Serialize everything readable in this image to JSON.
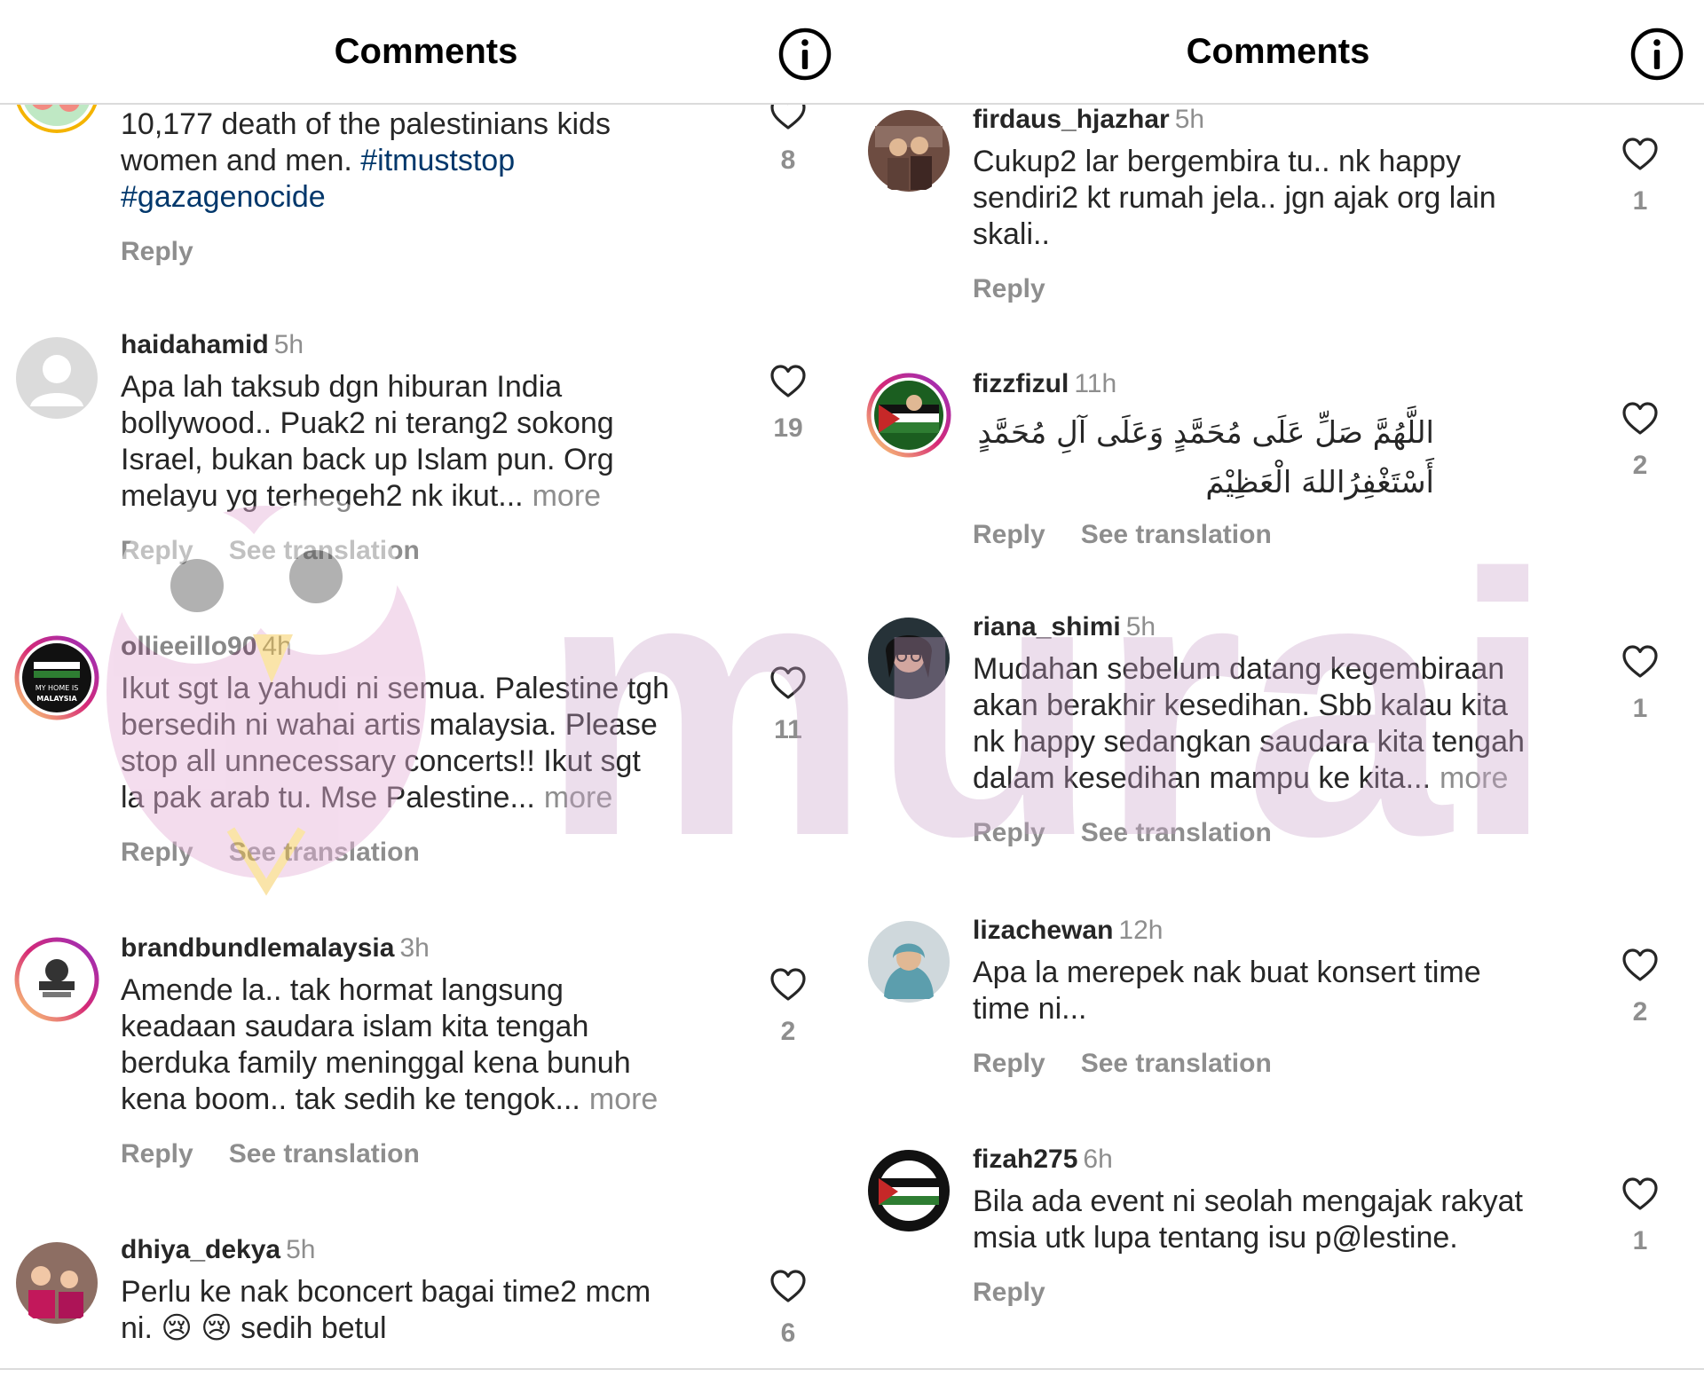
{
  "left": {
    "title": "Comments",
    "comments": [
      {
        "username": "",
        "time": "",
        "text_plain": "10,177 death of the palestinians kids\nwomen and men. ",
        "tag1": "#itmuststop",
        "tag2": "#gazagenocide",
        "reply": "Reply",
        "translation": "",
        "likes": "8"
      },
      {
        "username": "haidahamid",
        "time": "5h",
        "text": "Apa lah taksub dgn hiburan India\nbollywood.. Puak2 ni terang2 sokong\nIsrael, bukan back up Islam pun. Org\nmelayu yg terhegeh2 nk ikut...",
        "more": "more",
        "reply": "Reply",
        "translation": "See translation",
        "likes": "19"
      },
      {
        "username": "ollieeillo90",
        "time": "4h",
        "text": "Ikut sgt la yahudi ni semua. Palestine tgh\nbersedih ni wahai artis malaysia. Please\nstop all unnecessary concerts!! Ikut sgt\nla pak arab tu. Mse Palestine...",
        "more": "more",
        "reply": "Reply",
        "translation": "See translation",
        "likes": "11",
        "avatar_text1": "MY HOME IS",
        "avatar_text2": "MALAYSIA"
      },
      {
        "username": "brandbundlemalaysia",
        "time": "3h",
        "text": "Amende la.. tak hormat langsung\nkeadaan saudara islam kita tengah\nberduka family meninggal kena bunuh\nkena boom.. tak sedih ke tengok...",
        "more": "more",
        "reply": "Reply",
        "translation": "See translation",
        "likes": "2"
      },
      {
        "username": "dhiya_dekya",
        "time": "5h",
        "text": "Perlu ke nak bconcert bagai time2 mcm\nni. 😢 😢  sedih betul",
        "more": "",
        "reply": "",
        "translation": "",
        "likes": "6"
      }
    ]
  },
  "right": {
    "title": "Comments",
    "comments": [
      {
        "username": "firdaus_hjazhar",
        "time": "5h",
        "text": "Cukup2 lar bergembira tu.. nk happy\nsendiri2 kt rumah jela.. jgn ajak org lain\nskali..",
        "more": "",
        "reply": "Reply",
        "translation": "",
        "likes": "1"
      },
      {
        "username": "fizzfizul",
        "time": "11h",
        "text": "اللَّهُمَّ صَلِّ عَلَى مُحَمَّدٍ وَعَلَى آلِ مُحَمَّدٍ\nأَسْتَغْفِرُاللهَ الْعَظِيْمَ",
        "more": "",
        "reply": "Reply",
        "translation": "See translation",
        "likes": "2"
      },
      {
        "username": "riana_shimi",
        "time": "5h",
        "text": "Mudahan sebelum datang kegembiraan\nakan berakhir kesedihan. Sbb kalau kita\nnk happy sedangkan saudara kita tengah\ndalam kesedihan mampu ke kita...",
        "more": "more",
        "reply": "Reply",
        "translation": "See translation",
        "likes": "1"
      },
      {
        "username": "lizachewan",
        "time": "12h",
        "text": "Apa la merepek nak buat konsert time\ntime ni...",
        "more": "",
        "reply": "Reply",
        "translation": "See translation",
        "likes": "2"
      },
      {
        "username": "fizah275",
        "time": "6h",
        "text": "Bila ada event ni seolah mengajak rakyat\nmsia utk lupa tentang isu p@lestine.",
        "more": "",
        "reply": "Reply",
        "translation": "",
        "likes": "1"
      }
    ]
  },
  "watermark": {
    "text": "murai"
  },
  "icons": {
    "info": "info-icon",
    "heart": "heart-outline-icon"
  },
  "colors": {
    "text": "#262626",
    "muted": "#8e8e8e",
    "hashtag": "#00376b",
    "watermark": "#d9c4d9"
  }
}
